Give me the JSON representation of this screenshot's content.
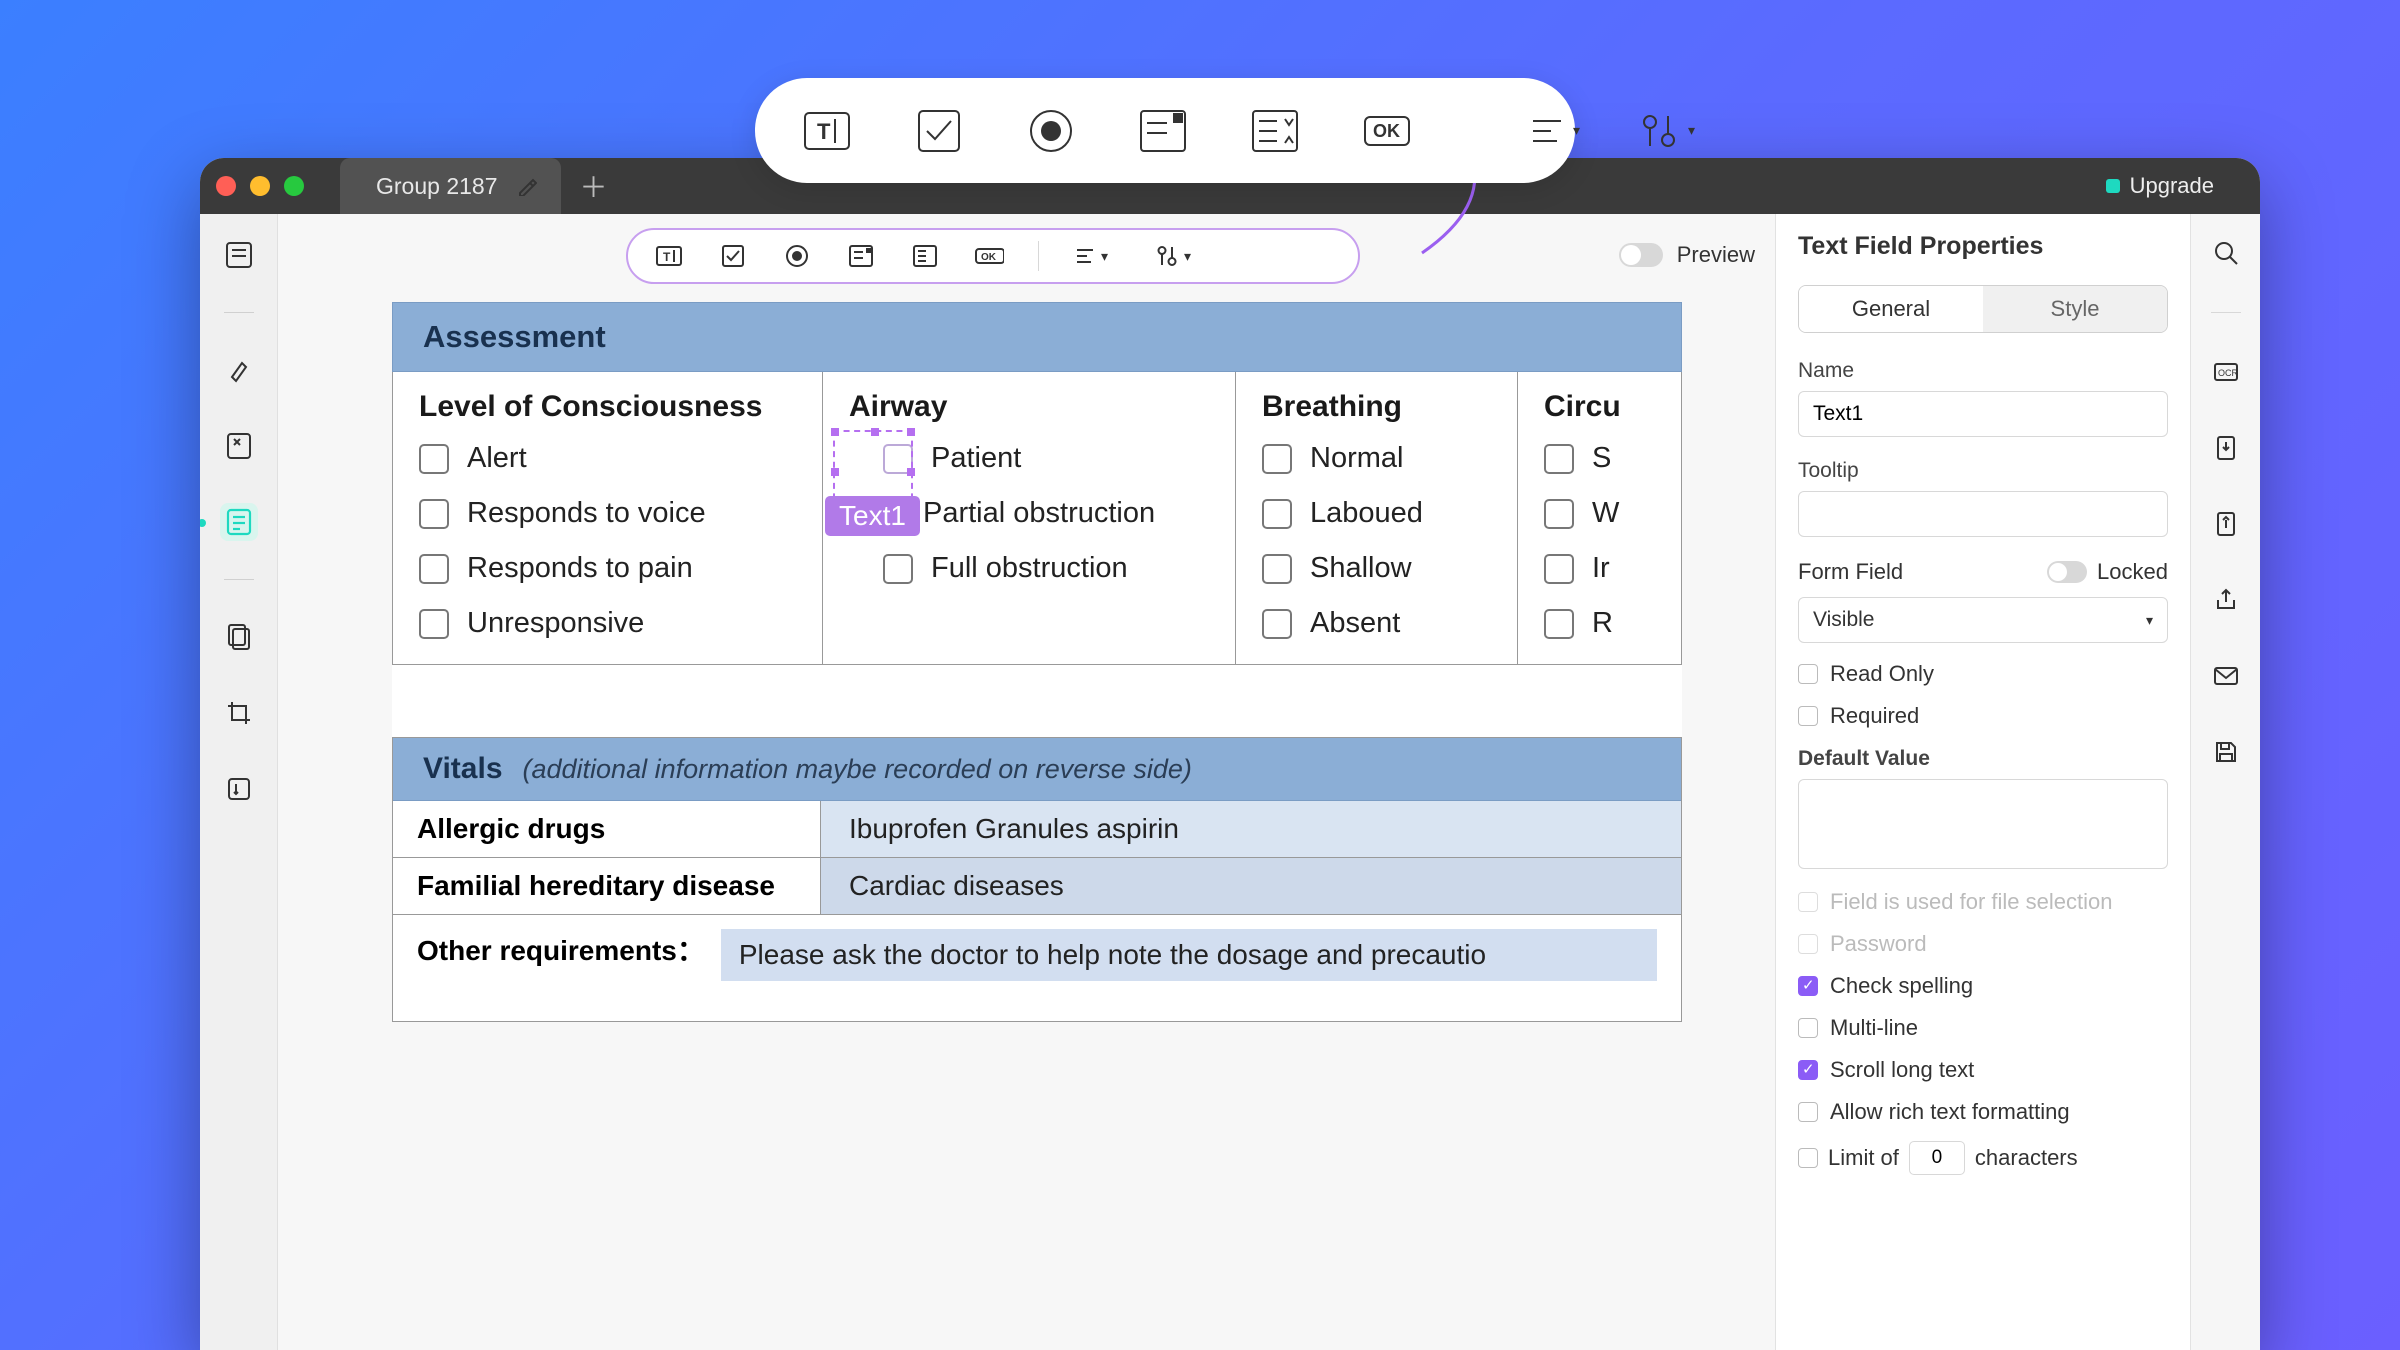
{
  "titlebar": {
    "tab_name": "Group 2187",
    "upgrade_label": "Upgrade"
  },
  "inner_toolbar": {
    "preview_label": "Preview"
  },
  "doc": {
    "assessment_header": "Assessment",
    "cols": {
      "loc_title": "Level of Consciousness",
      "loc_items": [
        "Alert",
        "Responds to voice",
        "Responds to pain",
        "Unresponsive"
      ],
      "airway_title": "Airway",
      "airway_items": [
        "Patient",
        "Partial obstruction",
        "Full obstruction"
      ],
      "airway_field_badge": "Text1",
      "breathing_title": "Breathing",
      "breathing_items": [
        "Normal",
        "Laboued",
        "Shallow",
        "Absent"
      ],
      "circ_title": "Circu",
      "circ_items": [
        "S",
        "W",
        "Ir",
        "R"
      ]
    },
    "vitals": {
      "header": "Vitals",
      "subtitle": "(additional information maybe recorded on reverse side)",
      "rows": [
        {
          "label": "Allergic drugs",
          "value": "Ibuprofen Granules  aspirin"
        },
        {
          "label": "Familial hereditary disease",
          "value": "Cardiac diseases"
        }
      ],
      "other_label": "Other requirements：",
      "other_value": "Please ask the doctor to help note the dosage and precautio"
    }
  },
  "props": {
    "title": "Text Field Properties",
    "tabs": {
      "general": "General",
      "style": "Style"
    },
    "name_label": "Name",
    "name_value": "Text1",
    "tooltip_label": "Tooltip",
    "tooltip_value": "",
    "formfield_label": "Form Field",
    "locked_label": "Locked",
    "visibility_value": "Visible",
    "readonly_label": "Read Only",
    "required_label": "Required",
    "default_label": "Default Value",
    "file_sel_label": "Field is used for file selection",
    "password_label": "Password",
    "spell_label": "Check spelling",
    "multiline_label": "Multi-line",
    "scroll_label": "Scroll long text",
    "rich_label": "Allow rich text formatting",
    "limit_label": "Limit of",
    "limit_value": "0",
    "chars_label": "characters"
  }
}
